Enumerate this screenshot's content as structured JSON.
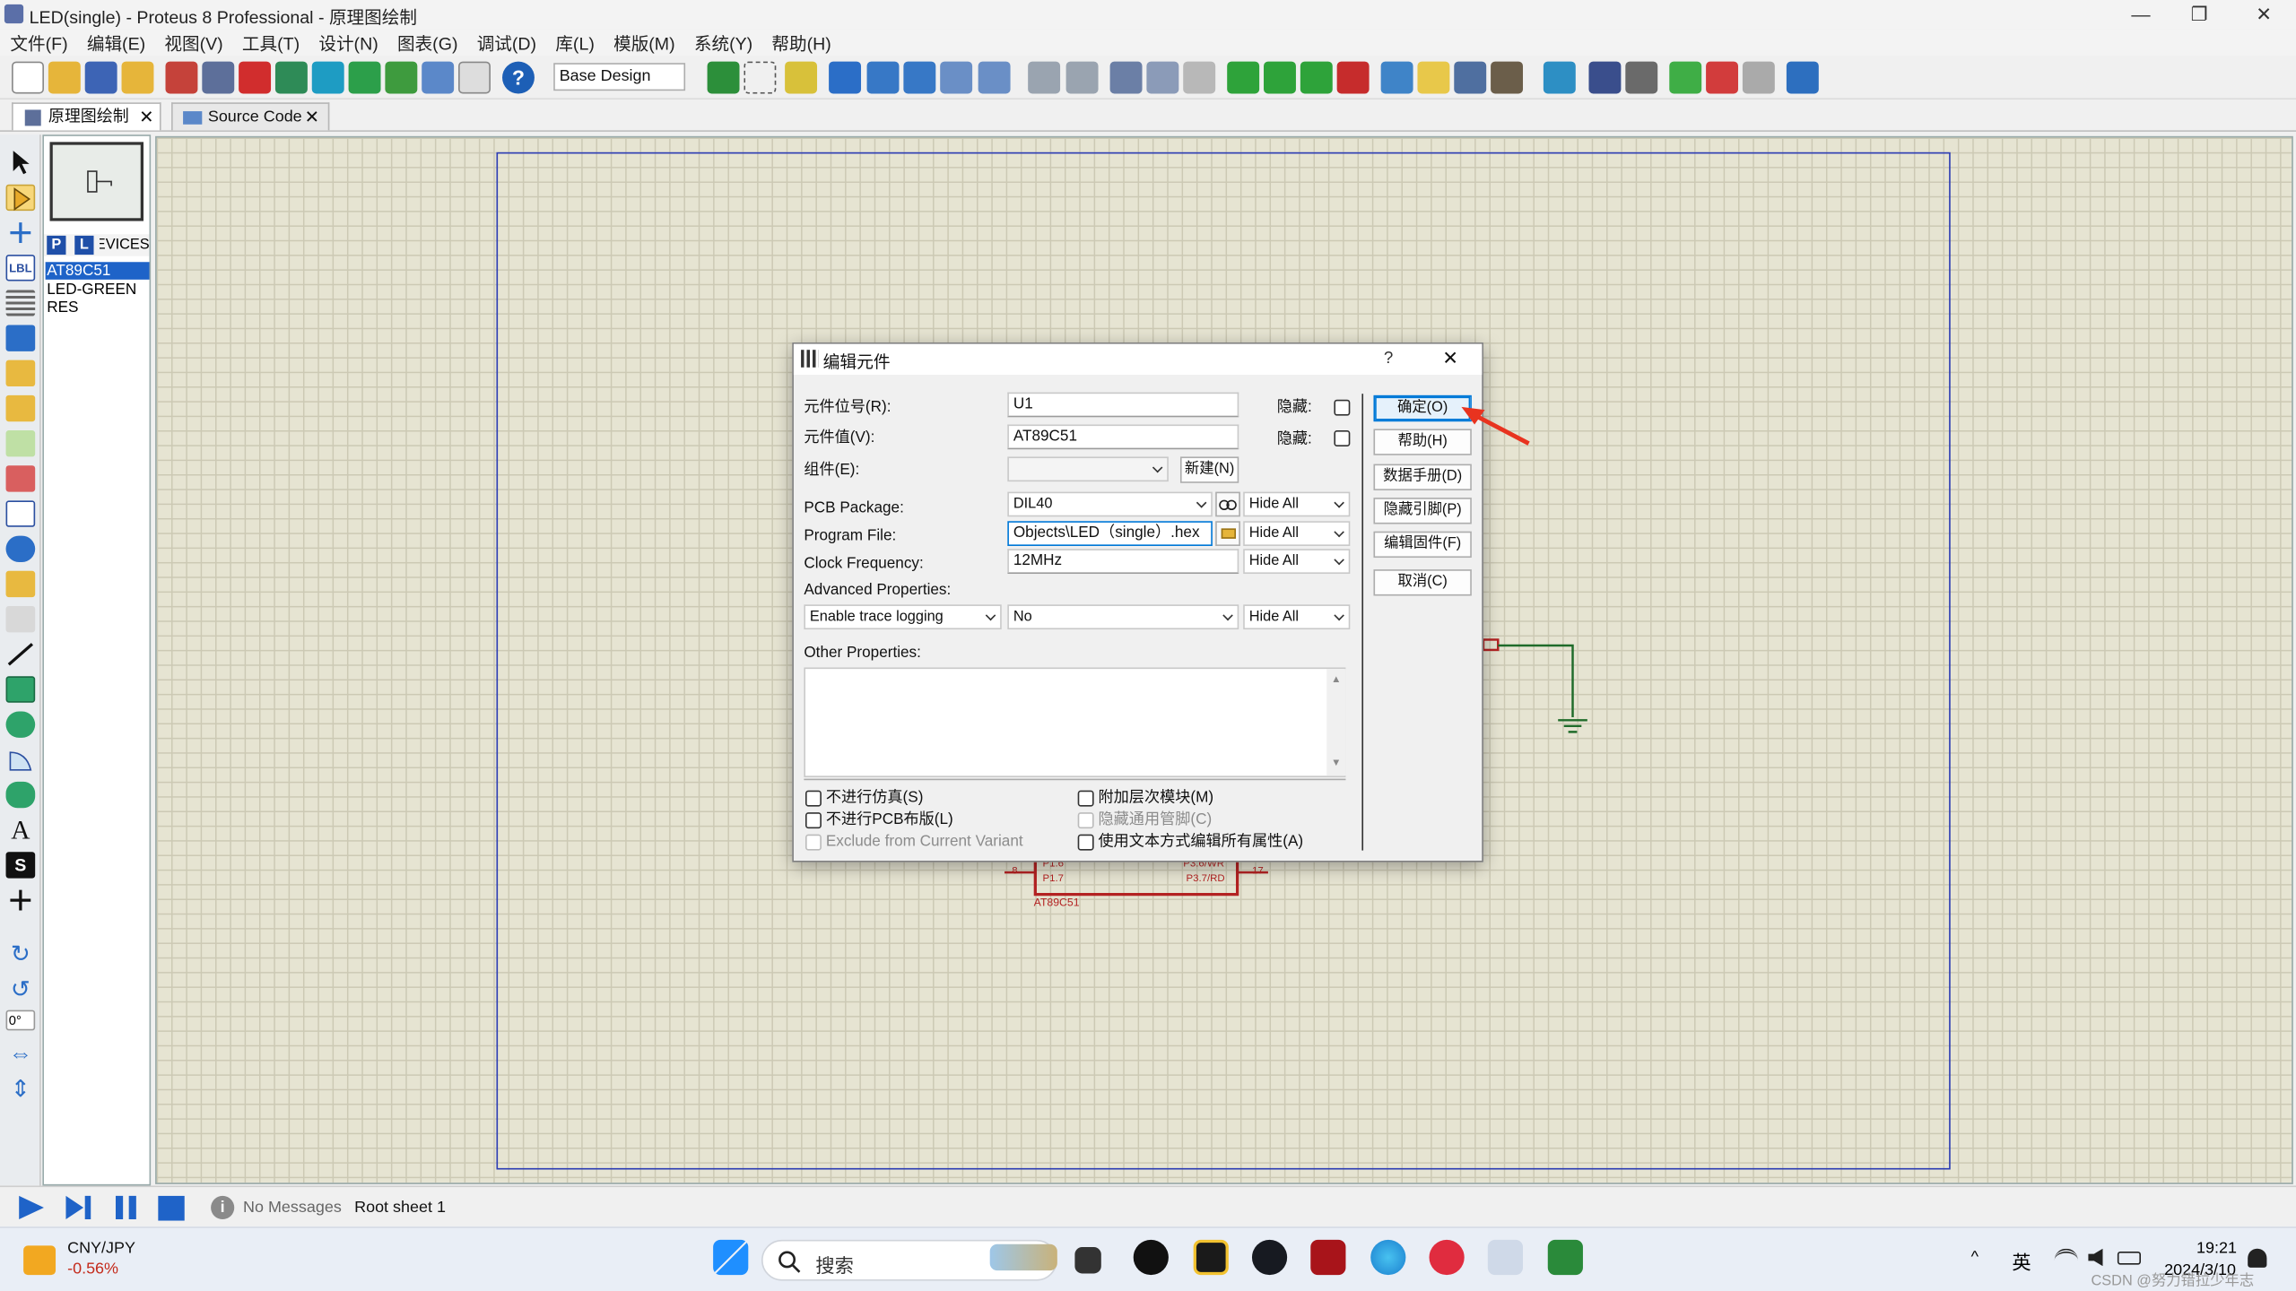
{
  "window": {
    "title": "LED(single) - Proteus 8 Professional - 原理图绘制",
    "minimize": "—",
    "maximize": "❐",
    "close": "✕"
  },
  "menu": [
    "文件(F)",
    "编辑(E)",
    "视图(V)",
    "工具(T)",
    "设计(N)",
    "图表(G)",
    "调试(D)",
    "库(L)",
    "模版(M)",
    "系统(Y)",
    "帮助(H)"
  ],
  "toolbar": {
    "design_select": "Base Design"
  },
  "tabs": [
    {
      "label": "原理图绘制"
    },
    {
      "label": "Source Code"
    }
  ],
  "devices": {
    "header": "DEVICES",
    "p": "P",
    "l": "L",
    "items": [
      "AT89C51",
      "LED-GREEN",
      "RES"
    ],
    "selected": "AT89C51"
  },
  "leftbar": {
    "rotation": "0°",
    "lbl": "LBL"
  },
  "schematic": {
    "chip_label": "AT89C51",
    "pin8": "8",
    "pin17": "17",
    "p16": "P1.6",
    "p17": "P1.7",
    "p36": "P3.6/WR",
    "p37": "P3.7/RD"
  },
  "status": {
    "messages": "No Messages",
    "sheet": "Root sheet 1"
  },
  "dialog": {
    "title": "编辑元件",
    "help": "?",
    "close": "✕",
    "ref_label": "元件位号(R):",
    "ref_value": "U1",
    "hidden1": "隐藏:",
    "value_label": "元件值(V):",
    "value_value": "AT89C51",
    "hidden2": "隐藏:",
    "group_label": "组件(E):",
    "new_btn": "新建(N)",
    "pcb_label": "PCB Package:",
    "pcb_value": "DIL40",
    "pcb_vis": "Hide All",
    "program_label": "Program File:",
    "program_value": "Objects\\LED（single）.hex",
    "program_vis": "Hide All",
    "clock_label": "Clock Frequency:",
    "clock_value": "12MHz",
    "clock_vis": "Hide All",
    "adv_label": "Advanced Properties:",
    "adv_prop": "Enable trace logging",
    "adv_value": "No",
    "adv_vis": "Hide All",
    "other_label": "Other Properties:",
    "chk_nosim": "不进行仿真(S)",
    "chk_nopcb": "不进行PCB布版(L)",
    "chk_exclude": "Exclude from Current Variant",
    "chk_hier": "附加层次模块(M)",
    "chk_hidepins": "隐藏通用管脚(C)",
    "chk_textedit": "使用文本方式编辑所有属性(A)",
    "buttons": {
      "ok": "确定(O)",
      "help": "帮助(H)",
      "datasheet": "数据手册(D)",
      "hidepins": "隐藏引脚(P)",
      "firmware": "编辑固件(F)",
      "cancel": "取消(C)"
    }
  },
  "taskbar": {
    "ticker": "CNY/JPY",
    "change": "-0.56%",
    "search": "搜索",
    "ime": "英",
    "time": "19:21",
    "date": "2024/3/10",
    "watermark": "CSDN @努力错拉少年志"
  }
}
